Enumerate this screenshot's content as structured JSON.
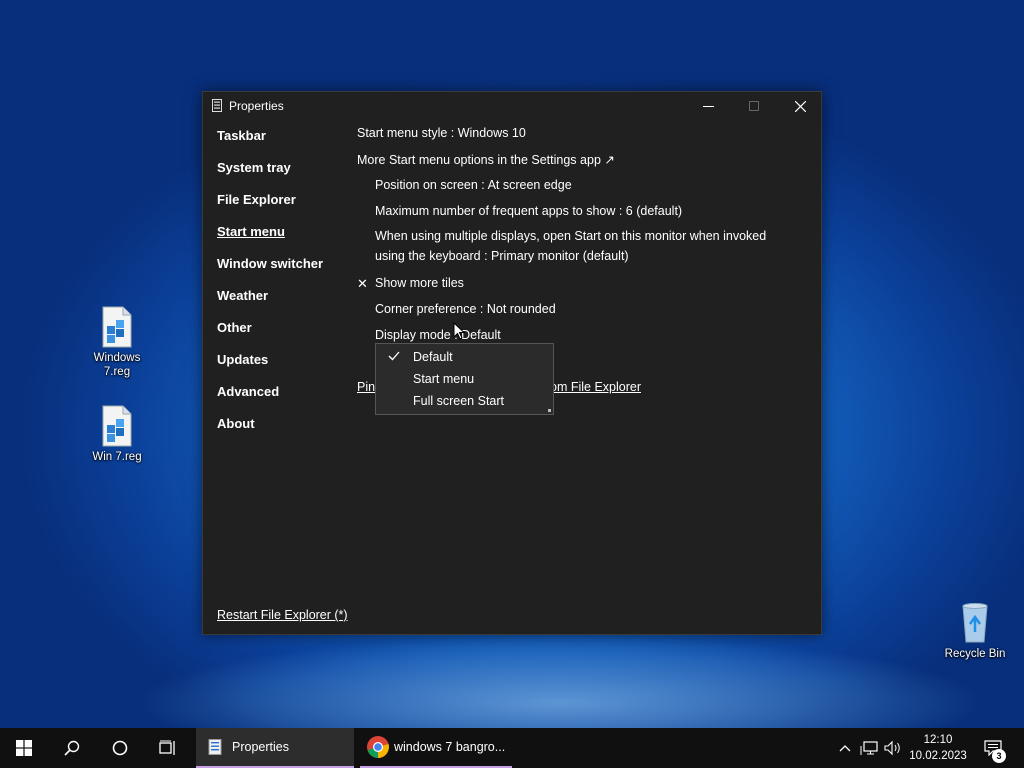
{
  "desktop": {
    "icons": [
      {
        "label": "Windows 7.reg"
      },
      {
        "label": "Win 7.reg"
      },
      {
        "label": "Recycle Bin"
      }
    ]
  },
  "window": {
    "title": "Properties",
    "controls": {
      "minimize": "minimize-icon",
      "maximize": "maximize-icon",
      "close": "close-icon"
    },
    "nav": [
      "Taskbar",
      "System tray",
      "File Explorer",
      "Start menu",
      "Window switcher",
      "Weather",
      "Other",
      "Updates",
      "Advanced",
      "About"
    ],
    "active_nav": "Start menu",
    "settings": {
      "start_menu_style": "Start menu style : Windows 10",
      "more_options": "More Start menu options in the Settings app ↗",
      "position": "Position on screen : At screen edge",
      "max_frequent": "Maximum number of frequent apps to show : 6 (default)",
      "multi_display": "When using multiple displays, open Start on this monitor when invoked using the keyboard : Primary monitor (default)",
      "show_more_tiles_mark": "✕",
      "show_more_tiles": "Show more tiles",
      "corner": "Corner preference : Not rounded",
      "display_mode": "Display mode : Default",
      "pin_left": "Pin",
      "pin_right": "om File Explorer"
    },
    "dropdown": {
      "options": [
        "Default",
        "Start menu",
        "Full screen Start"
      ],
      "selected": "Default"
    },
    "footer_link": "Restart File Explorer (*)"
  },
  "taskbar": {
    "apps": [
      {
        "label": "Properties",
        "state": "active"
      },
      {
        "label": "windows 7 bangro...",
        "state": "open"
      }
    ],
    "time": "12:10",
    "date": "10.02.2023",
    "notification_count": "3",
    "accent": "#c8a0e8"
  }
}
